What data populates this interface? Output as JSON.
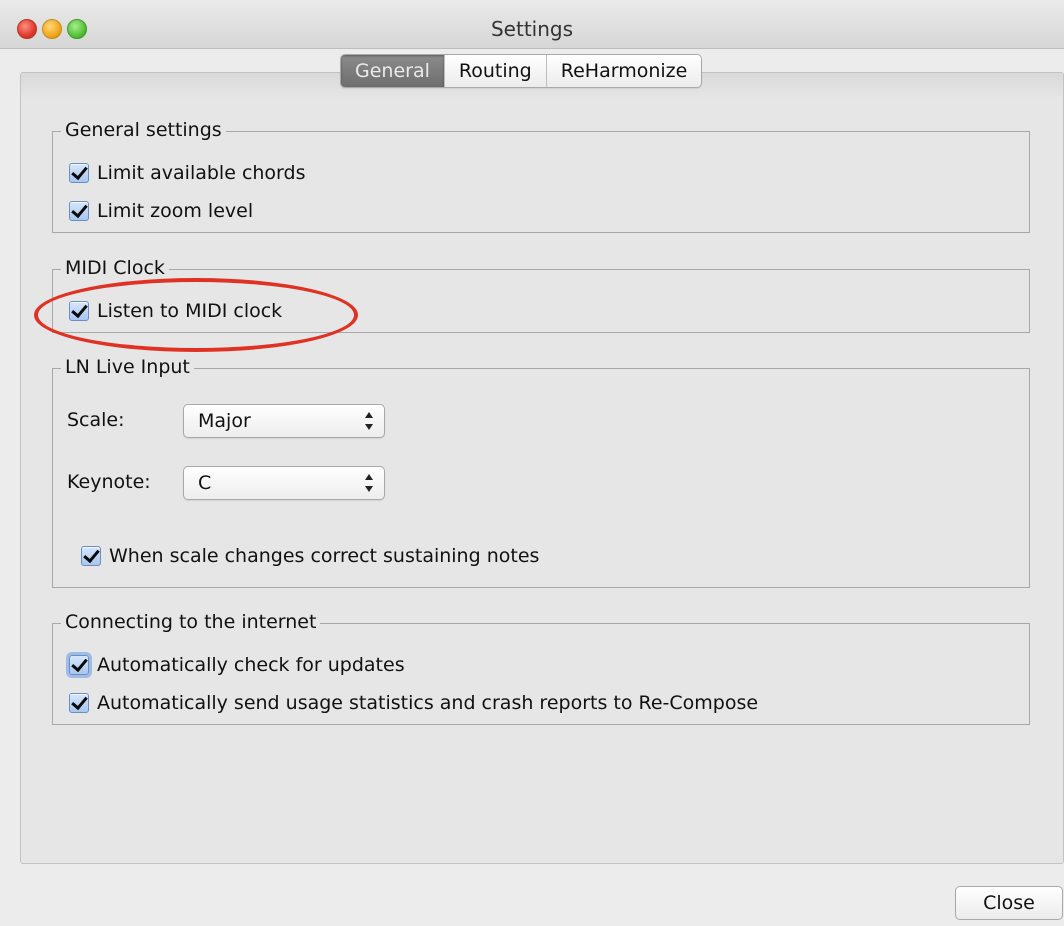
{
  "window": {
    "title": "Settings"
  },
  "tabs": [
    {
      "label": "General",
      "active": true
    },
    {
      "label": "Routing",
      "active": false
    },
    {
      "label": "ReHarmonize",
      "active": false
    }
  ],
  "general_settings": {
    "title": "General settings",
    "limit_chords": {
      "label": "Limit available chords",
      "checked": true
    },
    "limit_zoom": {
      "label": "Limit zoom level",
      "checked": true
    }
  },
  "midi_clock": {
    "title": "MIDI Clock",
    "listen": {
      "label": "Listen to MIDI clock",
      "checked": true
    }
  },
  "ln_live_input": {
    "title": "LN Live Input",
    "scale": {
      "label": "Scale:",
      "value": "Major"
    },
    "keynote": {
      "label": "Keynote:",
      "value": "C"
    },
    "correct_notes": {
      "label": "When scale changes correct sustaining notes",
      "checked": true
    }
  },
  "internet": {
    "title": "Connecting to the internet",
    "check_updates": {
      "label": "Automatically check for updates",
      "checked": true
    },
    "send_stats": {
      "label": "Automatically send usage statistics and crash reports to Re-Compose",
      "checked": true
    }
  },
  "footer": {
    "close_label": "Close"
  },
  "colors": {
    "annotation": "#e03224",
    "checkbox": "#a8c6f0",
    "active_tab": "#7a7a7a"
  }
}
